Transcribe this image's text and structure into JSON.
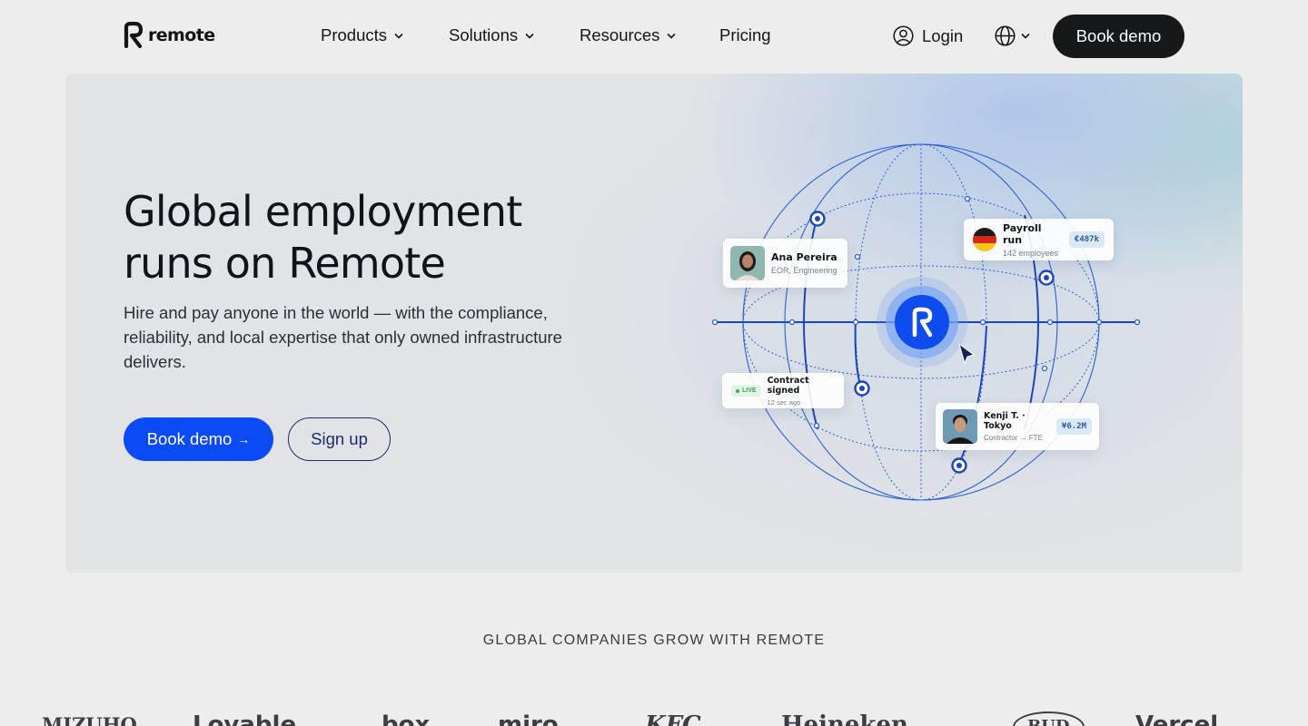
{
  "nav": {
    "logo_text": "remote",
    "items": [
      {
        "label": "Products"
      },
      {
        "label": "Solutions"
      },
      {
        "label": "Resources"
      },
      {
        "label": "Pricing"
      }
    ],
    "login_label": "Login",
    "book_demo_label": "Book demo"
  },
  "hero": {
    "title_line1": "Global employment",
    "title_line2": "runs on Remote",
    "subtitle": "Hire and pay anyone in the world — with the compliance, reliability, and local expertise that only owned infrastructure delivers.",
    "primary_cta": "Book demo",
    "primary_cta_arrow": "→",
    "secondary_cta": "Sign up",
    "cards": {
      "ana": {
        "name": "Ana Pereira",
        "detail": "EOR, Engineering"
      },
      "payroll": {
        "title": "Payroll run",
        "detail": "142 employees",
        "amount": "€487k"
      },
      "contract": {
        "badge": "LIVE",
        "title": "Contract signed",
        "detail": "12 sec ago"
      },
      "kenji": {
        "name": "Kenji T. · Tokyo",
        "detail": "Contractor → FTE",
        "amount": "¥6.2M"
      }
    }
  },
  "logos": {
    "heading": "GLOBAL COMPANIES GROW WITH REMOTE",
    "brands": [
      "MIZUHO",
      "Lovable",
      "box",
      "miro",
      "KFC",
      "Heineken",
      "BUD",
      "Vercel"
    ]
  },
  "colors": {
    "accent_blue": "#0a4bf5",
    "dark_button": "#17181c",
    "page_bg": "#ededee",
    "globe_line": "#2a5fd8"
  }
}
